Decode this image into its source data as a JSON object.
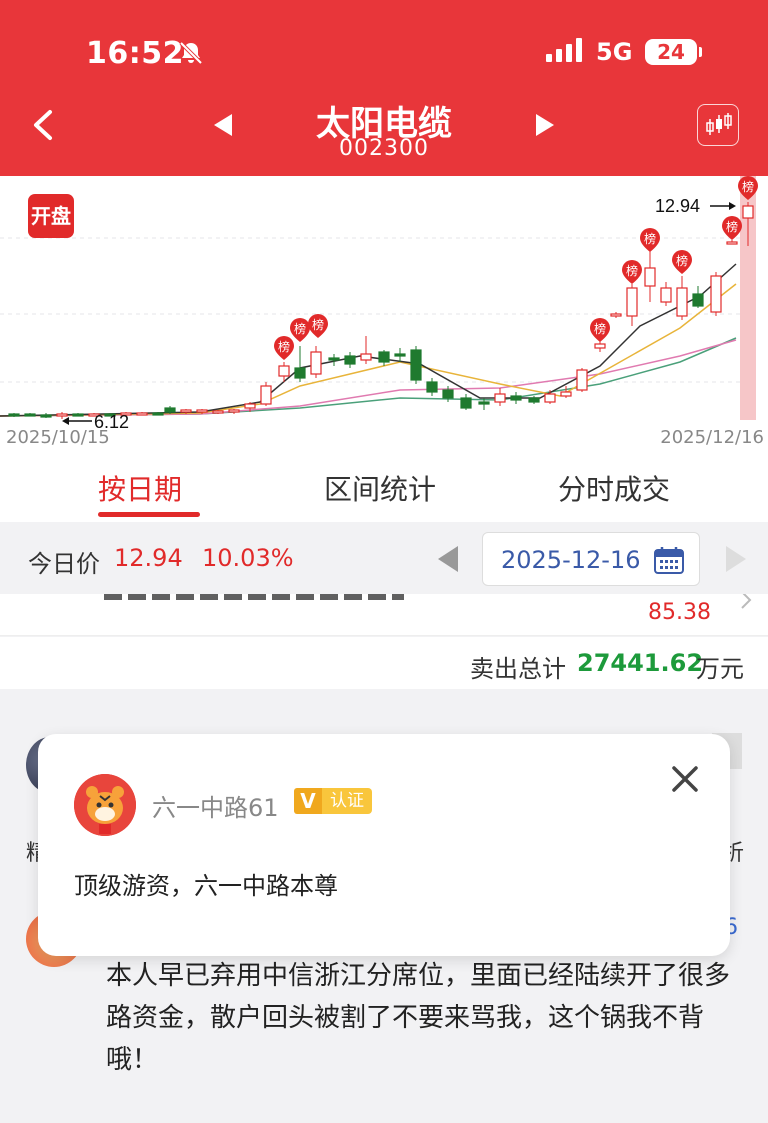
{
  "status_bar": {
    "time": "16:52",
    "network": "5G",
    "battery": "24"
  },
  "header": {
    "title": "太阳电缆",
    "code": "002300"
  },
  "chart": {
    "open_badge": "开盘",
    "start_date": "2025/10/15",
    "end_date": "2025/12/16",
    "high_label": "12.94",
    "low_label": "6.12",
    "list_badge": "榜",
    "colors": {
      "up": "#e12a2a",
      "down": "#1f7a2f",
      "ma5": "#333333",
      "ma10": "#e8b43a",
      "ma20": "#e07ab0",
      "ma30": "#4aa07a"
    }
  },
  "tabs": [
    {
      "label": "按日期",
      "active": true
    },
    {
      "label": "区间统计",
      "active": false
    },
    {
      "label": "分时成交",
      "active": false
    }
  ],
  "price_bar": {
    "label": "今日价",
    "price": "12.94",
    "change": "10.03%",
    "date": "2025-12-16"
  },
  "seat_row": {
    "amount": "85.38"
  },
  "sell_total": {
    "label": "卖出总计",
    "value": "27441.62",
    "unit": "万元"
  },
  "popup": {
    "username": "六一中路61",
    "badge_v": "V",
    "badge_label": "认证",
    "description": "顶级游资，六一中路本尊"
  },
  "comment": {
    "left_fragment": "精",
    "right_fragment": "析",
    "blue_fragment": "6",
    "text": "本人早已弃用中信浙江分席位，里面已经陆续开了很多路资金，散户回头被割了不要来骂我，这个锅我不背哦！"
  }
}
